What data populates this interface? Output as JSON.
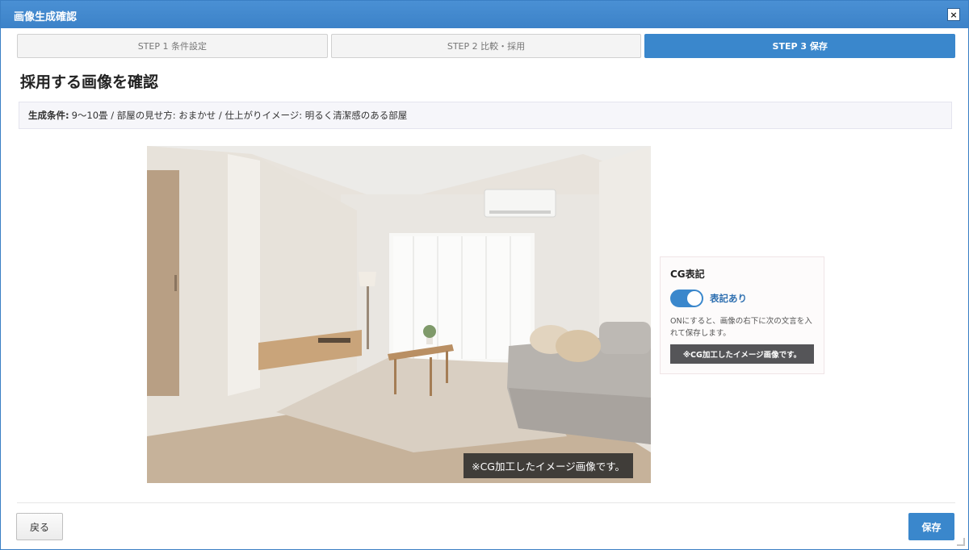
{
  "dialog": {
    "title": "画像生成確認",
    "close_label": "×"
  },
  "steps": [
    {
      "label": "STEP 1 条件設定",
      "active": false
    },
    {
      "label": "STEP 2 比較・採用",
      "active": false
    },
    {
      "label": "STEP 3 保存",
      "active": true
    }
  ],
  "page_title": "採用する画像を確認",
  "conditions": {
    "label": "生成条件:",
    "value": "9〜10畳 / 部屋の見せ方: おまかせ / 仕上がりイメージ: 明るく清潔感のある部屋"
  },
  "image": {
    "watermark": "※CG加工したイメージ画像です。"
  },
  "cg_panel": {
    "title": "CG表記",
    "toggle_on": true,
    "toggle_label": "表記あり",
    "description": "ONにすると、画像の右下に次の文言を入れて保存します。",
    "sample_text": "※CG加工したイメージ画像です。"
  },
  "footer": {
    "back_label": "戻る",
    "save_label": "保存"
  },
  "colors": {
    "accent": "#3a87cc",
    "titlebar": "#3c82c8"
  }
}
